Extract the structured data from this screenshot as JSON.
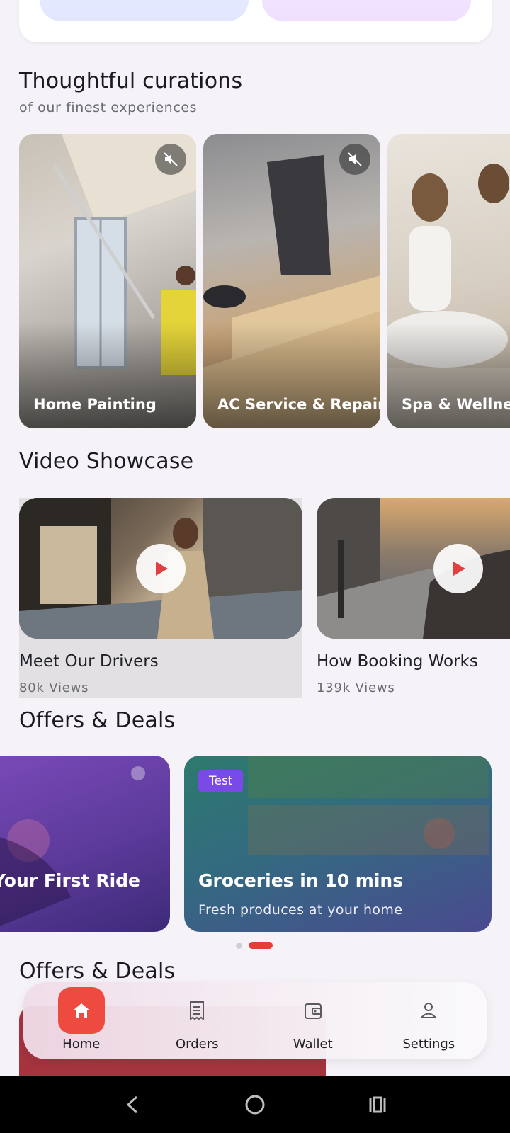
{
  "curations": {
    "title": "Thoughtful curations",
    "subtitle": "of our finest experiences",
    "items": [
      {
        "label": "Home Painting",
        "icon": "mute-icon"
      },
      {
        "label": "AC Service & Repair",
        "icon": "mute-icon"
      },
      {
        "label": "Spa & Wellness"
      }
    ]
  },
  "videos": {
    "title": "Video Showcase",
    "items": [
      {
        "title": "Meet Our Drivers",
        "views": "80k Views"
      },
      {
        "title": "How Booking Works",
        "views": "139k Views"
      }
    ]
  },
  "offers": {
    "title": "Offers & Deals",
    "items": [
      {
        "title": "Your First Ride"
      },
      {
        "badge": "Test",
        "title": "Groceries in 10 mins",
        "subtitle": "Fresh produces at your home"
      }
    ],
    "active_index": 1
  },
  "offers2": {
    "title": "Offers & Deals"
  },
  "nav": {
    "items": [
      {
        "label": "Home",
        "icon": "home-icon",
        "active": true
      },
      {
        "label": "Orders",
        "icon": "receipt-icon"
      },
      {
        "label": "Wallet",
        "icon": "wallet-icon"
      },
      {
        "label": "Settings",
        "icon": "person-icon"
      }
    ]
  },
  "colors": {
    "accent": "#ee4a40",
    "badge": "#7b49e6"
  }
}
